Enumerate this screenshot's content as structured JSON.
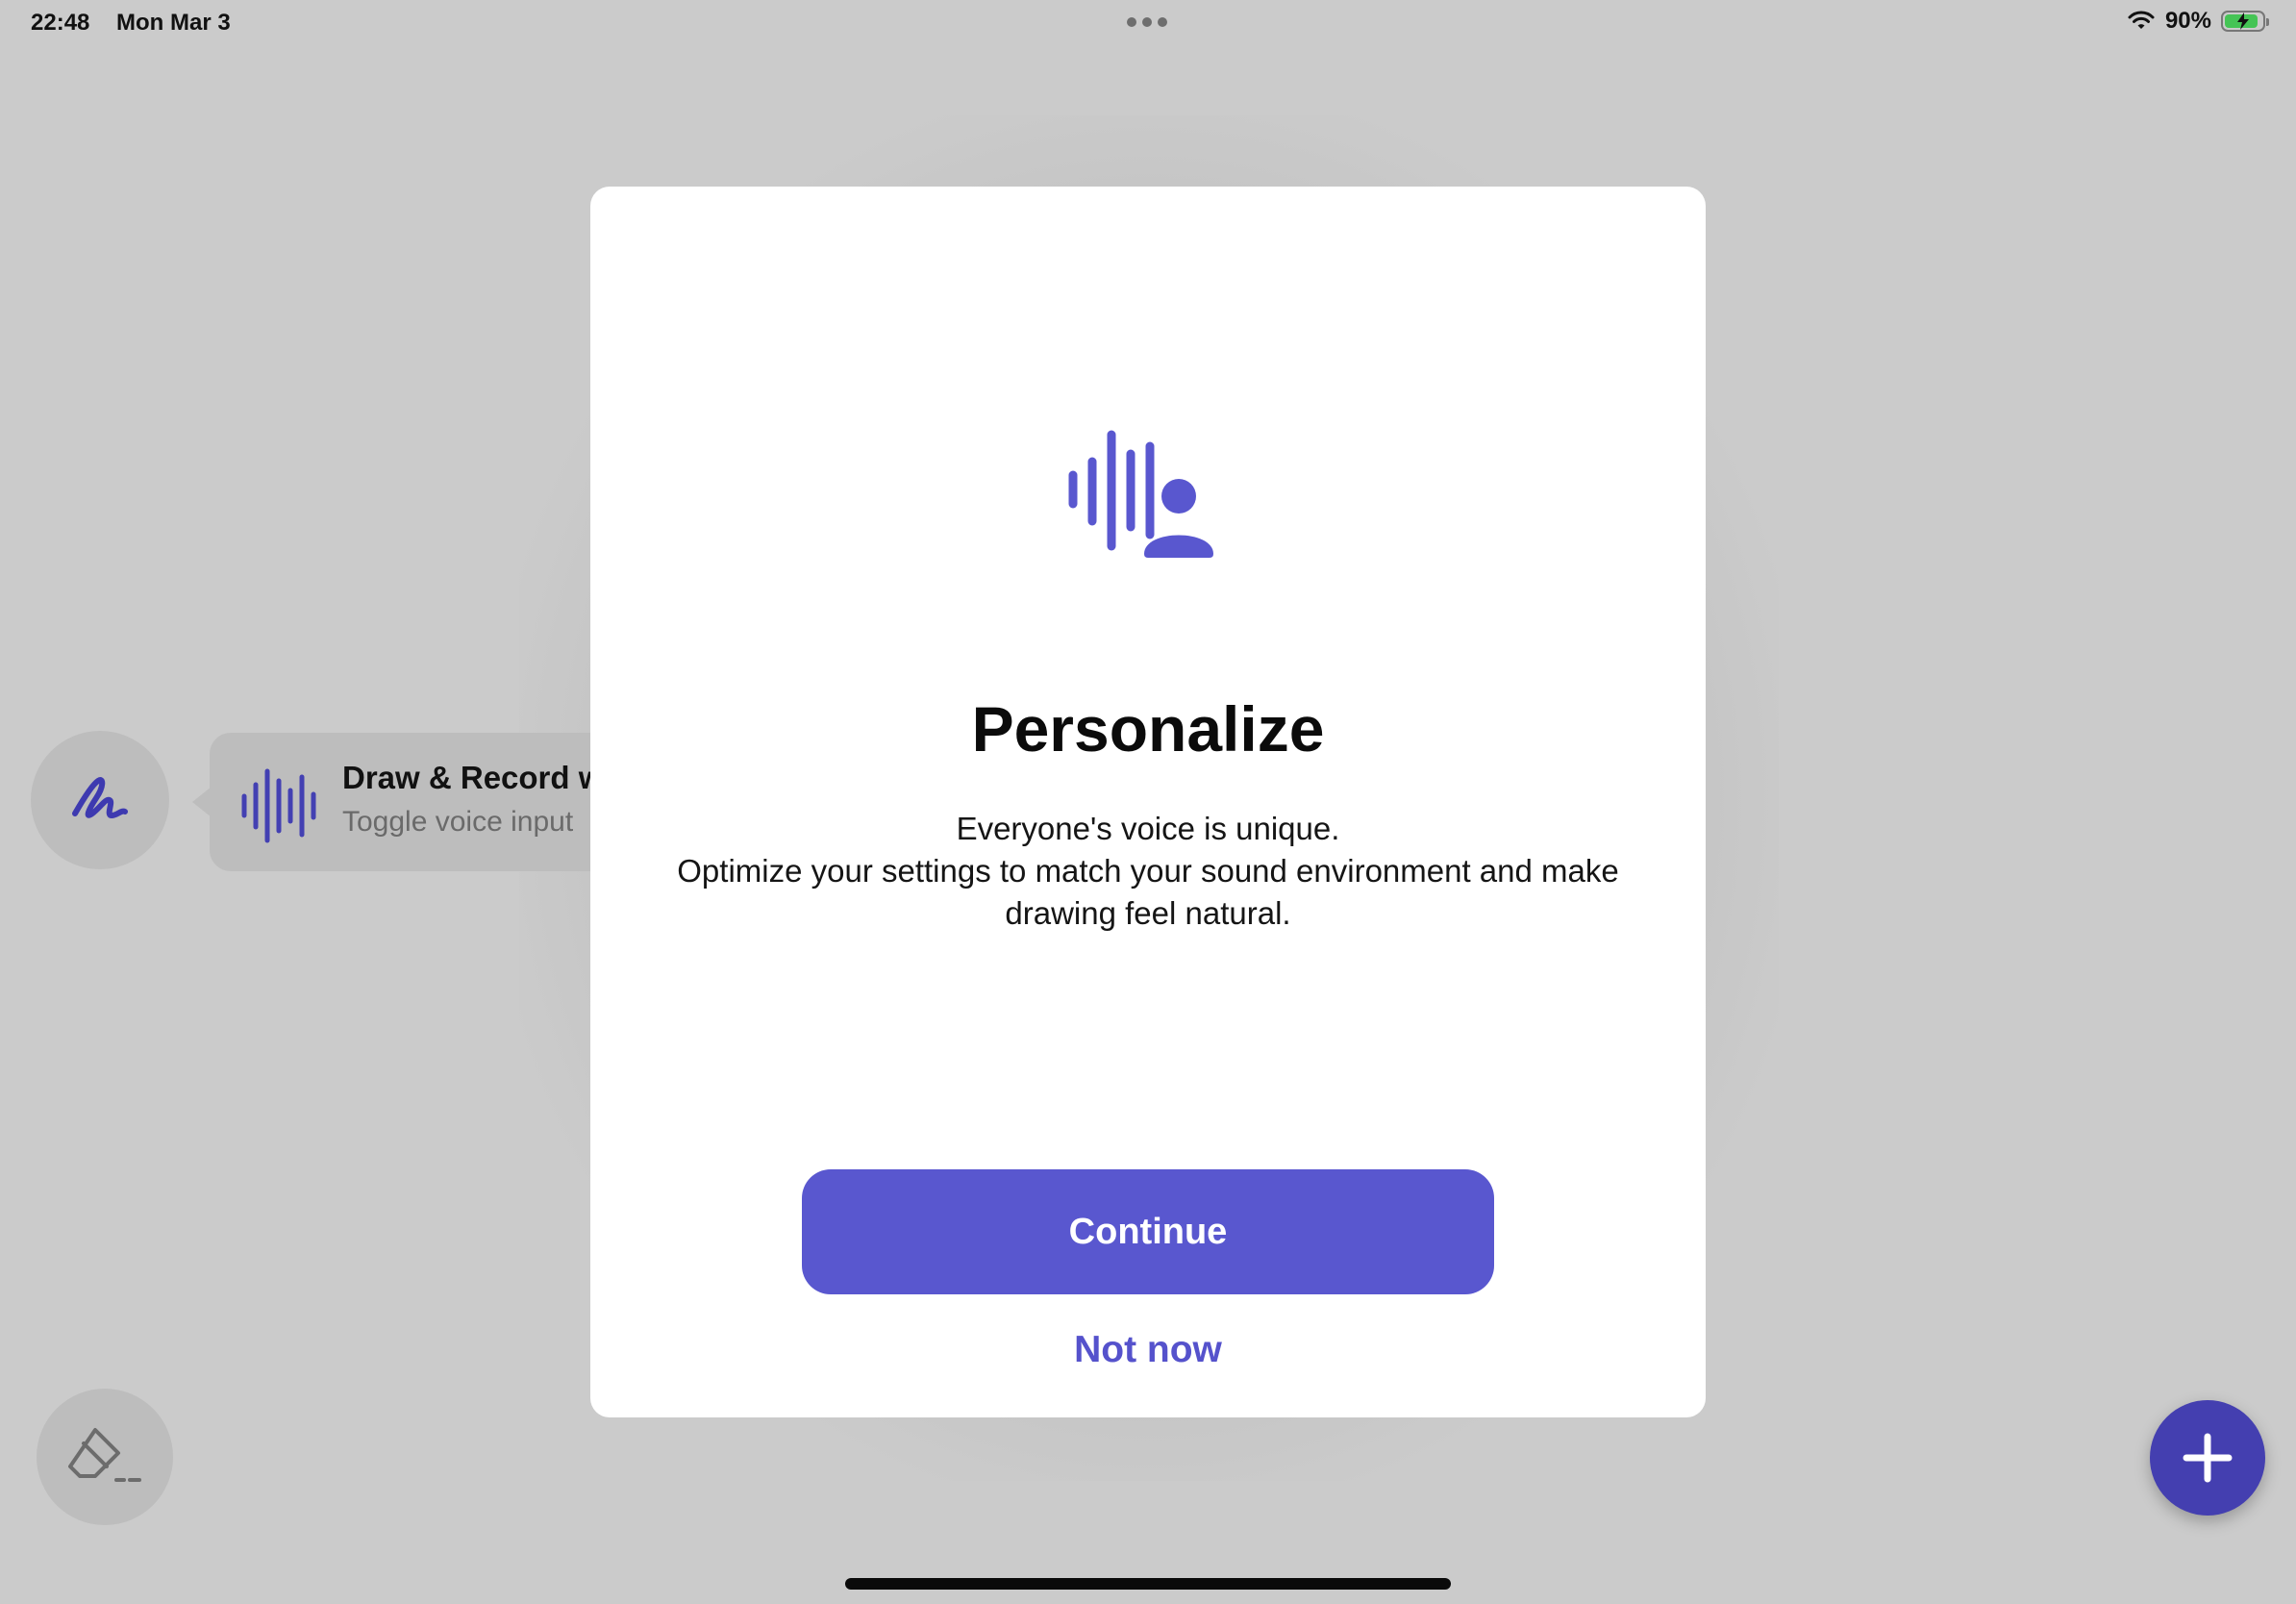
{
  "status_bar": {
    "time": "22:48",
    "date": "Mon Mar 3",
    "battery_percent": "90%",
    "battery_level": 0.9,
    "battery_charging": true
  },
  "toolbar": {
    "draw_icon": "scribble-icon",
    "eraser_icon": "eraser-icon",
    "add_icon": "plus-icon"
  },
  "hint_pill": {
    "title": "Draw & Record w",
    "subtitle": "Toggle voice input",
    "icon": "waveform-icon"
  },
  "modal": {
    "icon": "voice-profile-icon",
    "title": "Personalize",
    "body_line1": "Everyone's voice is unique.",
    "body_line2": "Optimize your settings to match your sound environment and make drawing feel natural.",
    "continue_label": "Continue",
    "not_now_label": "Not now"
  },
  "colors": {
    "accent": "#5957cf",
    "accent_dark": "#443fb0",
    "background": "#cbcbcb",
    "battery_green": "#45c455"
  }
}
